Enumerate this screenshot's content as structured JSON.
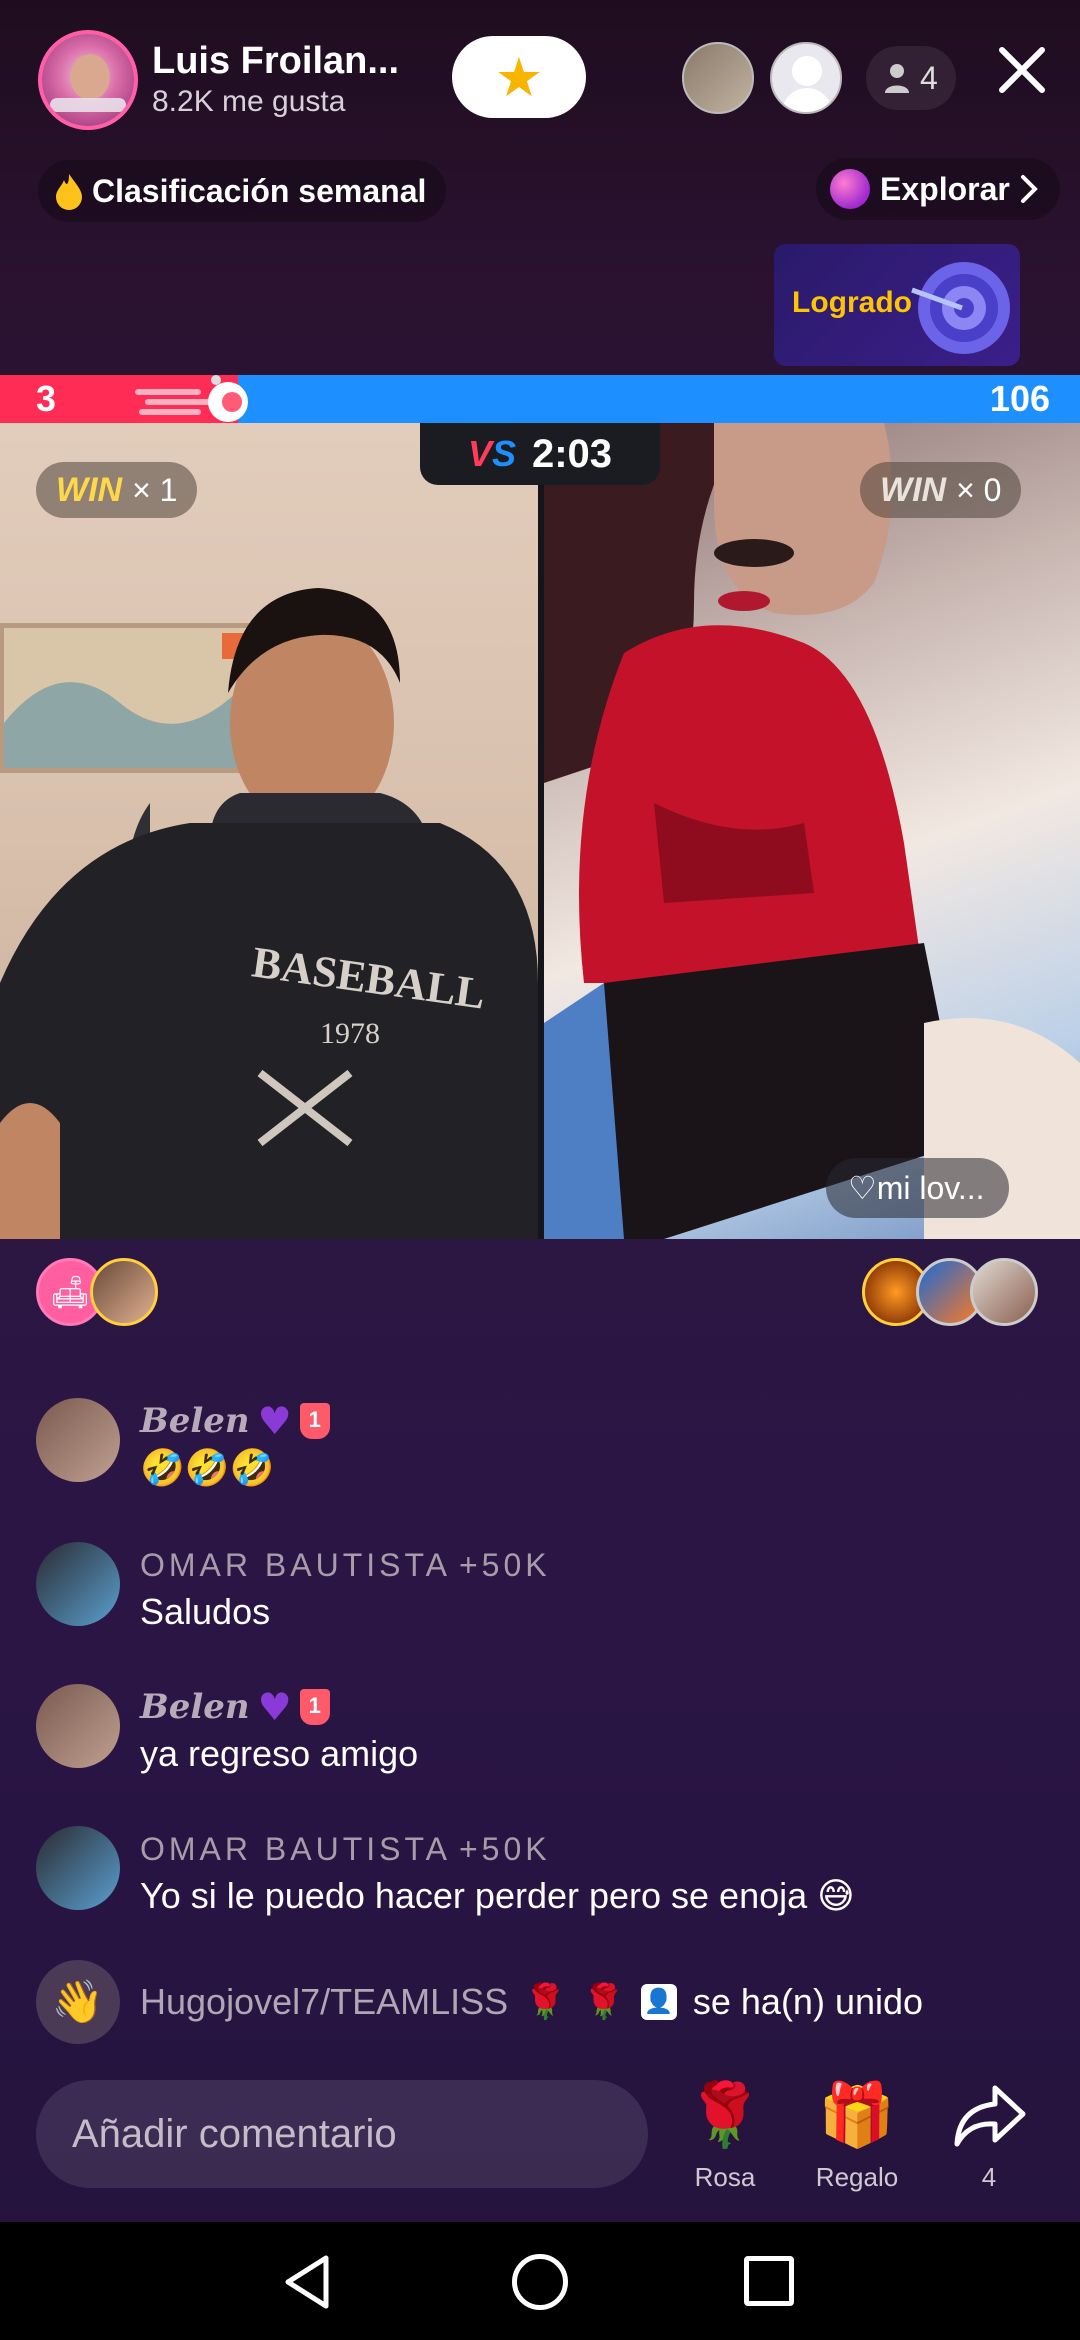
{
  "host": {
    "name": "Luis Froilan...",
    "likes": "8.2K me gusta"
  },
  "viewers": {
    "count": "4"
  },
  "weekly_ranking": "Clasificación semanal",
  "explore": "Explorar",
  "achievement": "Logrado",
  "battle": {
    "left_score": "3",
    "right_score": "106",
    "left_score_fraction": 0.22,
    "vs": "VS",
    "timer": "2:03",
    "left_win_label": "WIN",
    "left_win_count": "× 1",
    "right_win_label": "WIN",
    "right_win_count": "× 0",
    "right_tag": "♡mi lov..."
  },
  "chat": [
    {
      "name": "Belen",
      "message": "🤣🤣🤣"
    },
    {
      "name": "OMAR BAUTISTA",
      "suffix": "+50K",
      "message": "Saludos"
    },
    {
      "name": "Belen",
      "message": "ya regreso amigo"
    },
    {
      "name": "OMAR BAUTISTA",
      "suffix": "+50K",
      "message": "Yo si le puedo hacer perder pero se enoja 😅"
    }
  ],
  "rank_badge": "1",
  "joined": {
    "user": "Hugojovel7/TEAMLISS",
    "text": "se ha(n) unido"
  },
  "comment": {
    "placeholder": "Añadir comentario"
  },
  "actions": {
    "rose_label": "Rosa",
    "gift_label": "Regalo",
    "share_count": "4"
  },
  "colors": {
    "red_team": "#ff2c55",
    "blue_team": "#1d8fff",
    "gold": "#ffd84a"
  }
}
